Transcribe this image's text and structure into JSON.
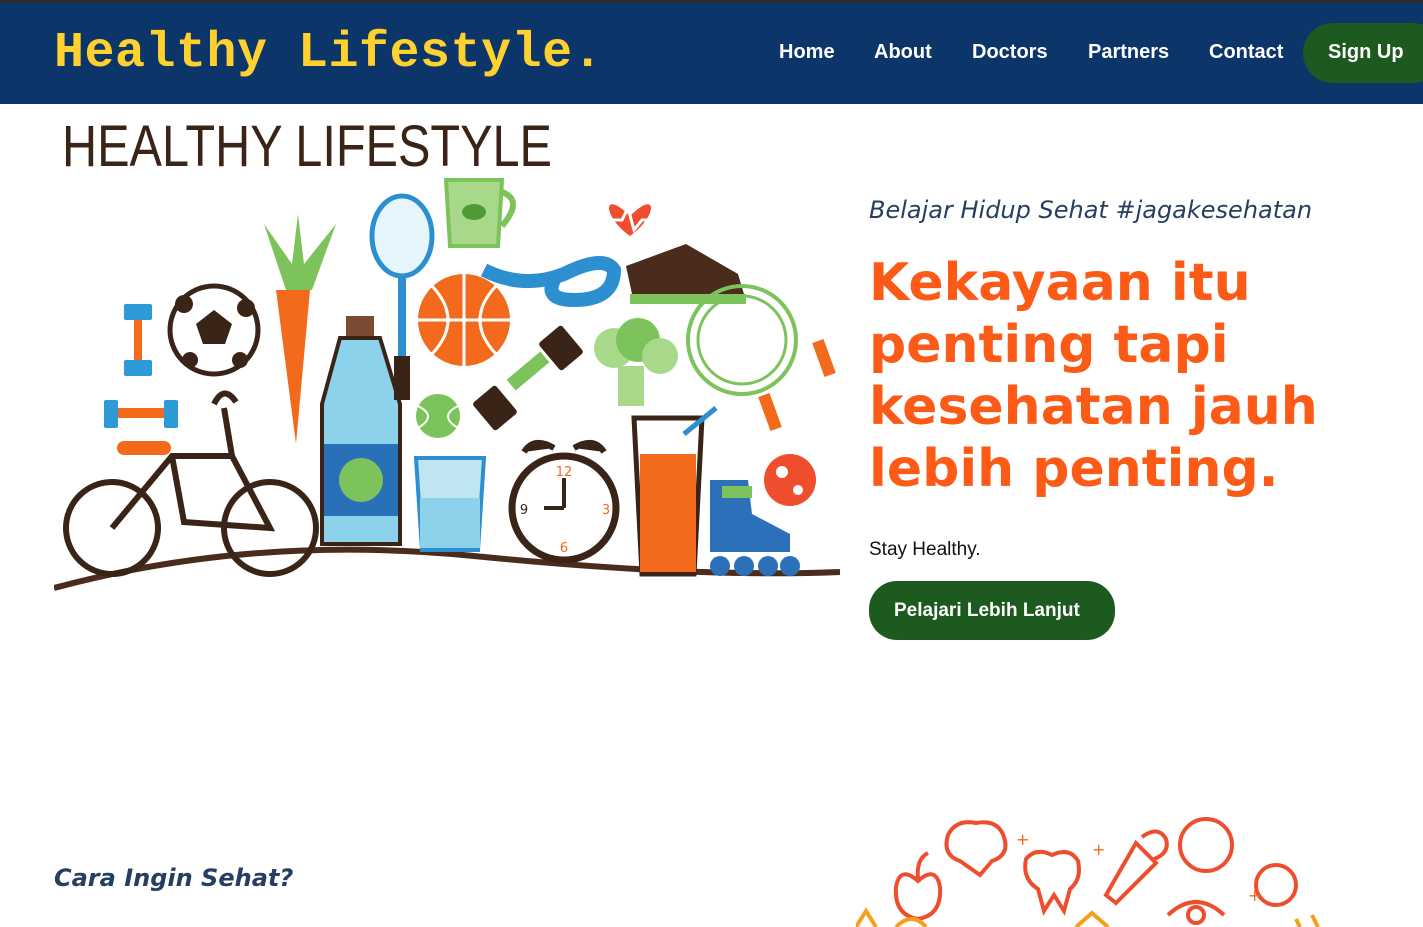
{
  "brand": "Healthy Lifestyle.",
  "nav": {
    "home": "Home",
    "about": "About",
    "doctors": "Doctors",
    "partners": "Partners",
    "contact": "Contact",
    "signup": "Sign Up"
  },
  "hero": {
    "image_caption": "HEALTHY LIFESTYLE",
    "tagline": "Belajar Hidup Sehat #jagakesehatan",
    "headline": "Kekayaan itu penting tapi kesehatan jauh lebih penting.",
    "subtext": "Stay Healthy.",
    "cta": "Pelajari Lebih Lanjut"
  },
  "section2": {
    "title": "Cara Ingin Sehat?"
  },
  "clock_numbers": [
    "12",
    "3",
    "6",
    "9"
  ],
  "colors": {
    "navbar": "#0c356a",
    "brand": "#ffd12e",
    "button": "#1c5a1f",
    "accent": "#fb5a17",
    "heading_text": "#263f61"
  },
  "icons": [
    "dumbbell-icon",
    "soccer-ball-icon",
    "carrot-icon",
    "water-bottle-icon",
    "racket-icon",
    "tea-cup-icon",
    "basketball-icon",
    "measuring-tape-icon",
    "heart-rate-icon",
    "sneaker-icon",
    "broccoli-icon",
    "jump-rope-icon",
    "bicycle-icon",
    "water-glass-icon",
    "alarm-clock-icon",
    "juice-glass-icon",
    "roller-skate-icon",
    "tennis-ball-icon",
    "brain-icon",
    "apple-icon",
    "tooth-icon",
    "eye-icon",
    "stopwatch-icon"
  ]
}
